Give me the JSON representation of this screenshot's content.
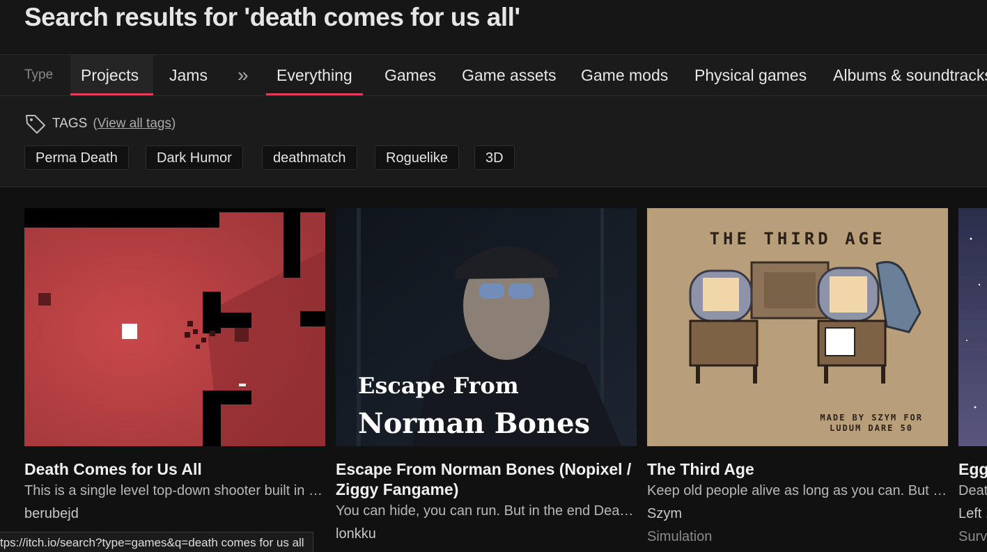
{
  "page": {
    "heading": "Search results for 'death comes for us all'"
  },
  "filters": {
    "type_label": "Type",
    "type_items": [
      "Projects",
      "Jams"
    ],
    "separator": "»",
    "category_items": [
      "Everything",
      "Games",
      "Game assets",
      "Game mods",
      "Physical games",
      "Albums & soundtracks"
    ],
    "active_color": "#e0404c"
  },
  "tags": {
    "title": "TAGS",
    "view_all_open": "(",
    "view_all": "View all tags",
    "view_all_close": ")",
    "items": [
      "Perma Death",
      "Dark Humor",
      "deathmatch",
      "Roguelike",
      "3D"
    ]
  },
  "results": [
    {
      "title": "Death Comes for Us All",
      "description": "This is a single level top-down shooter built in Unity for a game jam",
      "author": "berubejd",
      "genre": "",
      "thumb_icon": "red-topdown-level-thumbnail"
    },
    {
      "title": "Escape From Norman Bones (Nopixel / Ziggy Fangame)",
      "description": "You can hide, you can run. But in the end Death comes for us all",
      "author": "lonkku",
      "genre": "",
      "thumb_icon": "man-with-sunglasses-thumbnail",
      "thumb_text_1": "Escape From",
      "thumb_text_2": "Norman Bones"
    },
    {
      "title": "The Third Age",
      "description": "Keep old people alive as long as you can. But eventually death comes for us all",
      "author": "Szym",
      "genre": "Simulation",
      "thumb_icon": "pixel-elderly-couple-thumbnail",
      "thumb_text_1": "THE THIRD AGE",
      "thumb_text_2": "MADE BY SZYM FOR",
      "thumb_text_3": "LUDUM DARE 50"
    },
    {
      "title": "Egg...",
      "description": "Deat...",
      "author": "Left ...",
      "genre": "Surv...",
      "thumb_icon": "night-sky-thumbnail"
    }
  ],
  "status_url": "tps://itch.io/search?type=games&q=death comes for us all"
}
